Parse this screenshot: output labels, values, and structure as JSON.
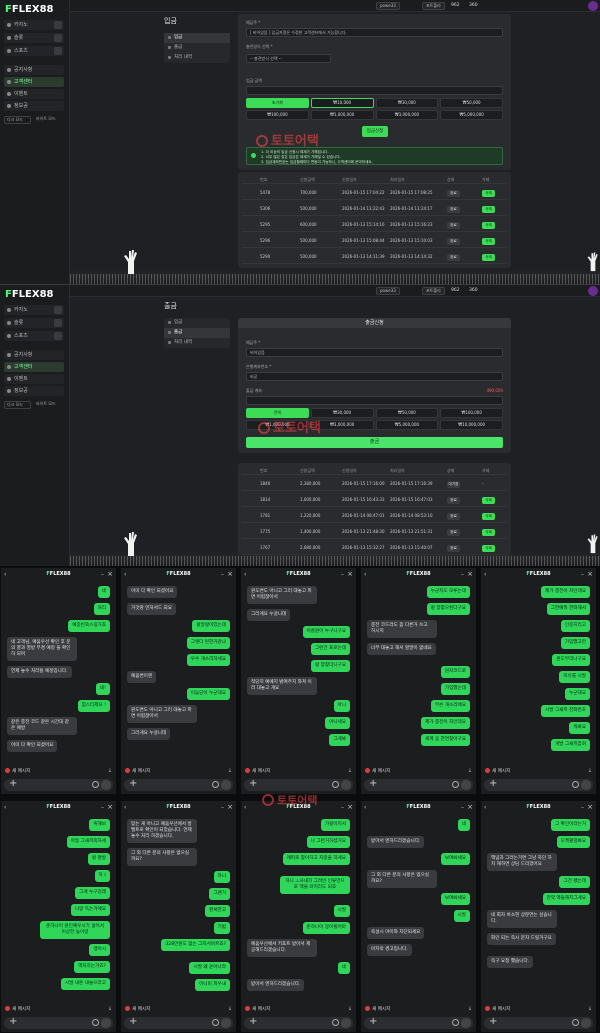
{
  "brand": {
    "prefix": "F",
    "name": "FLEX88",
    "accent": "#3ddc57"
  },
  "sidebar": {
    "items": [
      {
        "label": "카지노"
      },
      {
        "label": "슬롯"
      },
      {
        "label": "스포츠"
      },
      {
        "label": "공지사항"
      },
      {
        "label": "고객센터"
      },
      {
        "label": "이벤트"
      },
      {
        "label": "정보공"
      }
    ],
    "mode_select": "다크 모드",
    "mode_option": "라이트 모드"
  },
  "topbar": {
    "user": "powe33",
    "pill": "포트폴리",
    "balance": "962",
    "points": "360"
  },
  "deposit_page": {
    "title": "입금",
    "submenu": [
      "입금",
      "출금",
      "처리 내역"
    ],
    "field1_label": "예금주 *",
    "field1_value": "[ 비어있음 ] 입금자명은 수정한 고객센터에서 가능합니다.",
    "field2_label": "충전방식 선택 *",
    "field2_value": "-- 충전방식 선택 --",
    "amount_label": "입금 금액",
    "amount_buttons": [
      "초기화",
      "₩10,000",
      "₩30,000",
      "₩50,000",
      "₩100,000",
      "₩1,000,000",
      "₩3,000,000",
      "₩5,000,000"
    ],
    "apply_button": "입금신청",
    "notice_lines": [
      "1. 더 이상의 입금 신청시 제재가 가해집니다.",
      "2. 너무 많은 잦은 입금은 제재가 가해질 수 있습니다.",
      "3. 입금계좌번호는 입금할때마다 변동이 가능하니, 고객센터에 문의하세요."
    ],
    "table": {
      "headers": [
        "번호",
        "신청금액",
        "신청일자",
        "처리일자",
        "상태",
        "삭제"
      ],
      "rows": [
        [
          "5478",
          "700,000",
          "2026-01-15 17:04:22",
          "2026-01-15 17:08:25",
          "완료",
          "삭제"
        ],
        [
          "5306",
          "500,000",
          "2026-01-14 11:22:43",
          "2026-01-14 11:24:17",
          "완료",
          "삭제"
        ],
        [
          "5295",
          "600,000",
          "2026-01-13 15:14:16",
          "2026-01-13 15:16:23",
          "완료",
          "삭제"
        ],
        [
          "5296",
          "500,000",
          "2026-01-13 15:08:44",
          "2026-01-13 15:10:03",
          "완료",
          "삭제"
        ],
        [
          "5290",
          "500,000",
          "2026-01-13 14:11:39",
          "2026-01-13 14:14:32",
          "완료",
          "삭제"
        ]
      ]
    }
  },
  "withdraw_page": {
    "title": "출금",
    "submenu": [
      "입금",
      "출금",
      "처리 내역"
    ],
    "panel_title": "출금신청",
    "field1_label": "예금주 *",
    "field1_value": "비어있음",
    "field2_label": "은행계좌번호 *",
    "field2_value": "비공",
    "amount_label": "출금 계좌",
    "amount_right": "490,000",
    "amount_buttons": [
      "전액",
      "₩30,000",
      "₩50,000",
      "₩100,000",
      "₩1,000,000",
      "₩3,000,000",
      "₩5,000,000",
      "₩10,000,000"
    ],
    "apply_button": "출금",
    "table": {
      "headers": [
        "번호",
        "신청금액",
        "신청일자",
        "처리일자",
        "상태",
        "삭제"
      ],
      "rows": [
        [
          "1849",
          "2,380,000",
          "2026-01-15 17:16:00",
          "2026-01-15 17:16:39",
          "대기중",
          "-"
        ],
        [
          "1814",
          "1,600,000",
          "2026-01-15 16:43:33",
          "2026-01-15 16:47:03",
          "완료",
          "삭제"
        ],
        [
          "1781",
          "1,220,000",
          "2026-01-14 08:47:01",
          "2026-01-14 08:53:10",
          "완료",
          "삭제"
        ],
        [
          "1775",
          "1,400,000",
          "2026-01-13 21:48:30",
          "2026-01-13 21:51:31",
          "완료",
          "삭제"
        ],
        [
          "1767",
          "2,680,000",
          "2026-01-13 15:32:27",
          "2026-01-13 15:40:07",
          "완료",
          "삭제"
        ]
      ]
    }
  },
  "watermark": "토토어택",
  "chat": {
    "new_message": "새 메시지",
    "panels": [
      {
        "messages": [
          {
            "side": "me",
            "text": "네"
          },
          {
            "side": "me",
            "text": "처리"
          },
          {
            "side": "me",
            "text": "예중빈죽스링거죠"
          },
          {
            "side": "op",
            "text": "네 고객님, 예움우선 확인 후 문의 결과 영방 부경 예정\n을 확인 하 되며"
          },
          {
            "side": "op",
            "text": "언제 놓수 처리될 예정입니다."
          },
          {
            "side": "me",
            "text": "네!"
          },
          {
            "side": "me",
            "text": "힘스티제요 !"
          },
          {
            "side": "op",
            "text": "같은 충전 코드 같은 시간대 같은 예방"
          },
          {
            "side": "op",
            "text": "이미 다 확인 되셨어요"
          }
        ]
      },
      {
        "messages": [
          {
            "side": "op",
            "text": "이미 다 확인 되셨어요"
          },
          {
            "side": "op",
            "text": "거것땅 먼처서드 되요"
          },
          {
            "side": "me",
            "text": "왕알왕이었는데"
          },
          {
            "side": "me",
            "text": "그렇다 된한거같냐"
          },
          {
            "side": "me",
            "text": "우수 개소리하세요"
          },
          {
            "side": "op",
            "text": "예움변이엔"
          },
          {
            "side": "me",
            "text": "이놈당이 누군대요"
          },
          {
            "side": "op",
            "text": "원도변도 아니고 그러 대놓고 파면 어렵잖아서"
          },
          {
            "side": "op",
            "text": "그러게요 누굴니데"
          }
        ]
      },
      {
        "messages": [
          {
            "side": "op",
            "text": "원도변도 아니고 그러 대놓고 파면 어렵잖아서"
          },
          {
            "side": "op",
            "text": "그러게요 누굴니데"
          },
          {
            "side": "me",
            "text": "이름원이 누구니구요"
          },
          {
            "side": "me",
            "text": "그런건 프로는데"
          },
          {
            "side": "me",
            "text": "왕 양찾더니구요"
          },
          {
            "side": "op",
            "text": "적당히 예예지 밝여주지 와져 이 러 대놓고 개요"
          },
          {
            "side": "me",
            "text": "아니"
          },
          {
            "side": "me",
            "text": "아니세요"
          },
          {
            "side": "me",
            "text": "그게봐"
          }
        ]
      },
      {
        "messages": [
          {
            "side": "me",
            "text": "누군지도 모루는데"
          },
          {
            "side": "me",
            "text": "왕 양찾으된다구요"
          },
          {
            "side": "op",
            "text": "충전 코드라도 좀 다른거 쓰고 하시지"
          },
          {
            "side": "op",
            "text": "너무 대놓고 해서 할말이 없네요"
          },
          {
            "side": "me",
            "text": "원자코드로"
          },
          {
            "side": "me",
            "text": "가입했는데"
          },
          {
            "side": "me",
            "text": "무슨 개소리에요"
          },
          {
            "side": "me",
            "text": "제가 충전이 자인데요"
          },
          {
            "side": "me",
            "text": "세계 응 한연찾아구요"
          }
        ]
      },
      {
        "messages": [
          {
            "side": "me",
            "text": "제가 충전이 자인데요"
          },
          {
            "side": "me",
            "text": "그한예뭐 한와해서"
          },
          {
            "side": "me",
            "text": "인중지리고"
          },
          {
            "side": "me",
            "text": "가입했고만"
          },
          {
            "side": "me",
            "text": "원도부리나구요"
          },
          {
            "side": "me",
            "text": "미유를 시발"
          },
          {
            "side": "me",
            "text": "누군대요"
          },
          {
            "side": "me",
            "text": "시발 그새끼 잔화번호"
          },
          {
            "side": "me",
            "text": "워봐요"
          },
          {
            "side": "me",
            "text": "개발 그새끼잡혀"
          }
        ]
      },
      {
        "messages": [
          {
            "side": "me",
            "text": "위해보"
          },
          {
            "side": "me",
            "text": "아동 그새끼죽하세"
          },
          {
            "side": "me",
            "text": "왕 명방"
          },
          {
            "side": "me",
            "text": "하 ("
          },
          {
            "side": "me",
            "text": "그게 누구길래"
          },
          {
            "side": "me",
            "text": "나랑 똑는거에요"
          },
          {
            "side": "me",
            "text": "준하나이 원인예우시기 싫어서 이상한 높이랑"
          },
          {
            "side": "me",
            "text": "맹이시"
          },
          {
            "side": "me",
            "text": "액처하는거죠?"
          },
          {
            "side": "me",
            "text": "시발 내돈 내놓으라고"
          }
        ]
      },
      {
        "messages": [
          {
            "side": "op",
            "text": "맞는 게 아니고 예움우선에서 방 밸트로 확인이 되었습니다. 언제 놓수 처리 하겠습니다."
          },
          {
            "side": "op",
            "text": "그 외 다른 분의 사항은 없으실 까요?"
          },
          {
            "side": "me",
            "text": "하니"
          },
          {
            "side": "me",
            "text": "그랜거"
          },
          {
            "side": "me",
            "text": "판써만고"
          },
          {
            "side": "me",
            "text": "기범"
          },
          {
            "side": "me",
            "text": "328만원도 없는 그지서버르죠?"
          },
          {
            "side": "me",
            "text": "시발 왜 윤어나라"
          },
          {
            "side": "me",
            "text": "아니미 피우내"
          }
        ]
      },
      {
        "messages": [
          {
            "side": "me",
            "text": "가왕이지서"
          },
          {
            "side": "me",
            "text": "나 그런거하셨거요"
          },
          {
            "side": "me",
            "text": "캐떠로 찾아하고 지랑을 하게요"
          },
          {
            "side": "me",
            "text": "하니 ㅗ사내가 그려빈 인류만으로 액을 마지러도 되죠"
          },
          {
            "side": "me",
            "text": "시발"
          },
          {
            "side": "me",
            "text": "준하나이 봉이빌어마"
          },
          {
            "side": "op",
            "text": "예움우선에서 키포트 받아서 제공해드리겠습니다."
          },
          {
            "side": "me",
            "text": "네"
          },
          {
            "side": "op",
            "text": "받아서 엔하드리겠습니다."
          }
        ]
      },
      {
        "messages": [
          {
            "side": "me",
            "text": "네"
          },
          {
            "side": "op",
            "text": "받아서 엔하드리겠습니다."
          },
          {
            "side": "me",
            "text": "보여봐세요"
          },
          {
            "side": "op",
            "text": "그 외 다른 분의 사항은 없으실 까요?"
          },
          {
            "side": "me",
            "text": "보여봐세요"
          },
          {
            "side": "me",
            "text": "시발"
          },
          {
            "side": "op",
            "text": "욕설시 야이와 차단되세요"
          },
          {
            "side": "op",
            "text": "마지막 경고입니다."
          }
        ]
      },
      {
        "messages": [
          {
            "side": "me",
            "text": "그 확인이라는거"
          },
          {
            "side": "me",
            "text": "오케펄앞봐요"
          },
          {
            "side": "op",
            "text": "액념과 그러는거면 그냥 차단 하지 해하면 상담 드리겠어요"
          },
          {
            "side": "me",
            "text": "그건 됐는데"
          },
          {
            "side": "me",
            "text": "만약 액들해지그게요"
          },
          {
            "side": "op",
            "text": "네 회자 바소현 상분연는 싶습니다."
          },
          {
            "side": "op",
            "text": "화인 되는 즉시 문자 드릴거구요"
          },
          {
            "side": "op",
            "text": "즉구 요청 했습니다."
          }
        ]
      }
    ]
  }
}
